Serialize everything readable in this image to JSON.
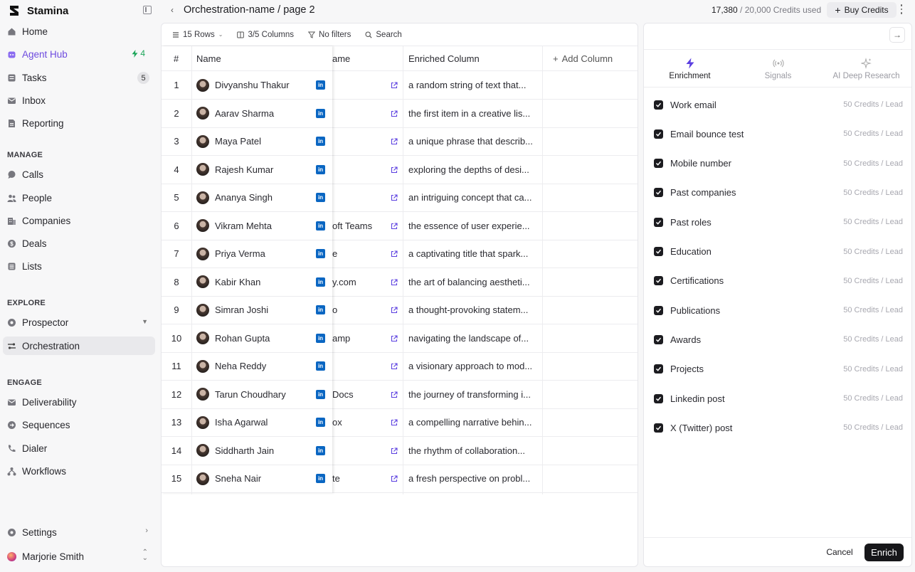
{
  "sidebar": {
    "brand": "Stamina",
    "items_top": [
      {
        "label": "Home",
        "icon": "home-icon"
      },
      {
        "label": "Agent Hub",
        "icon": "bot-icon",
        "badge": "4"
      },
      {
        "label": "Tasks",
        "icon": "tasks-icon",
        "badge": "5"
      },
      {
        "label": "Inbox",
        "icon": "inbox-icon"
      },
      {
        "label": "Reporting",
        "icon": "report-icon"
      }
    ],
    "manage_title": "MANAGE",
    "manage": [
      {
        "label": "Calls",
        "icon": "chat-icon"
      },
      {
        "label": "People",
        "icon": "people-icon"
      },
      {
        "label": "Companies",
        "icon": "building-icon"
      },
      {
        "label": "Deals",
        "icon": "dollar-icon"
      },
      {
        "label": "Lists",
        "icon": "list-icon"
      }
    ],
    "explore_title": "EXPLORE",
    "explore": [
      {
        "label": "Prospector",
        "icon": "compass-icon"
      },
      {
        "label": "Orchestration",
        "icon": "orchestration-icon"
      }
    ],
    "engage_title": "ENGAGE",
    "engage": [
      {
        "label": "Deliverability",
        "icon": "mail-icon"
      },
      {
        "label": "Sequences",
        "icon": "sequence-icon"
      },
      {
        "label": "Dialer",
        "icon": "phone-icon"
      },
      {
        "label": "Workflows",
        "icon": "workflow-icon"
      }
    ],
    "settings": "Settings",
    "user": "Marjorie Smith"
  },
  "topbar": {
    "title": "Orchestration-name / page 2",
    "credits_used": "17,380",
    "credits_total": "/ 20,000 Credits used",
    "buy_label": "Buy Credits"
  },
  "toolbar": {
    "rows": "15 Rows",
    "columns": "3/5 Columns",
    "filters": "No filters",
    "search": "Search"
  },
  "table": {
    "headers": {
      "num": "#",
      "name": "Name",
      "company": "ame",
      "enriched": "Enriched Column",
      "add": "Add Column"
    },
    "rows": [
      {
        "n": "1",
        "name": "Divyanshu Thakur",
        "company": "",
        "enriched": "a random string of text that..."
      },
      {
        "n": "2",
        "name": "Aarav Sharma",
        "company": "",
        "enriched": "the first item in a creative lis..."
      },
      {
        "n": "3",
        "name": "Maya Patel",
        "company": "",
        "enriched": "a unique phrase that describ..."
      },
      {
        "n": "4",
        "name": "Rajesh Kumar",
        "company": "",
        "enriched": "exploring the depths of desi..."
      },
      {
        "n": "5",
        "name": "Ananya Singh",
        "company": "",
        "enriched": "an intriguing concept that ca..."
      },
      {
        "n": "6",
        "name": "Vikram Mehta",
        "company": "oft Teams",
        "enriched": "the essence of user experie..."
      },
      {
        "n": "7",
        "name": "Priya Verma",
        "company": "e",
        "enriched": "a captivating title that spark..."
      },
      {
        "n": "8",
        "name": "Kabir Khan",
        "company": "y.com",
        "enriched": "the art of balancing aestheti..."
      },
      {
        "n": "9",
        "name": "Simran Joshi",
        "company": "o",
        "enriched": "a thought-provoking statem..."
      },
      {
        "n": "10",
        "name": "Rohan Gupta",
        "company": "amp",
        "enriched": "navigating the landscape of..."
      },
      {
        "n": "11",
        "name": "Neha Reddy",
        "company": "",
        "enriched": "a visionary approach to mod..."
      },
      {
        "n": "12",
        "name": "Tarun Choudhary",
        "company": "Docs",
        "enriched": "the journey of transforming i..."
      },
      {
        "n": "13",
        "name": "Isha Agarwal",
        "company": "ox",
        "enriched": "a compelling narrative behin..."
      },
      {
        "n": "14",
        "name": "Siddharth Jain",
        "company": "",
        "enriched": "the rhythm of collaboration..."
      },
      {
        "n": "15",
        "name": "Sneha Nair",
        "company": "te",
        "enriched": "a fresh perspective on probl..."
      }
    ]
  },
  "panel": {
    "tabs": [
      {
        "label": "Enrichment",
        "icon": "bolt-icon",
        "active": true
      },
      {
        "label": "Signals",
        "icon": "signal-icon",
        "active": false
      },
      {
        "label": "AI Deep Research",
        "icon": "sparkle-icon",
        "active": false
      }
    ],
    "options": [
      {
        "label": "Work email",
        "cost": "50 Credits / Lead"
      },
      {
        "label": "Email bounce test",
        "cost": "50 Credits / Lead"
      },
      {
        "label": "Mobile number",
        "cost": "50 Credits / Lead"
      },
      {
        "label": "Past companies",
        "cost": "50 Credits / Lead"
      },
      {
        "label": "Past roles",
        "cost": "50 Credits / Lead"
      },
      {
        "label": "Education",
        "cost": "50 Credits / Lead"
      },
      {
        "label": "Certifications",
        "cost": "50 Credits / Lead"
      },
      {
        "label": "Publications",
        "cost": "50 Credits / Lead"
      },
      {
        "label": "Awards",
        "cost": "50 Credits / Lead"
      },
      {
        "label": "Projects",
        "cost": "50 Credits / Lead"
      },
      {
        "label": "Linkedin post",
        "cost": "50 Credits / Lead"
      },
      {
        "label": "X (Twitter) post",
        "cost": "50 Credits / Lead"
      }
    ],
    "cancel": "Cancel",
    "enrich": "Enrich"
  },
  "colors": {
    "accent": "#6d4adf",
    "linkedin": "#0a66c2",
    "bolt_green": "#1da65a"
  }
}
